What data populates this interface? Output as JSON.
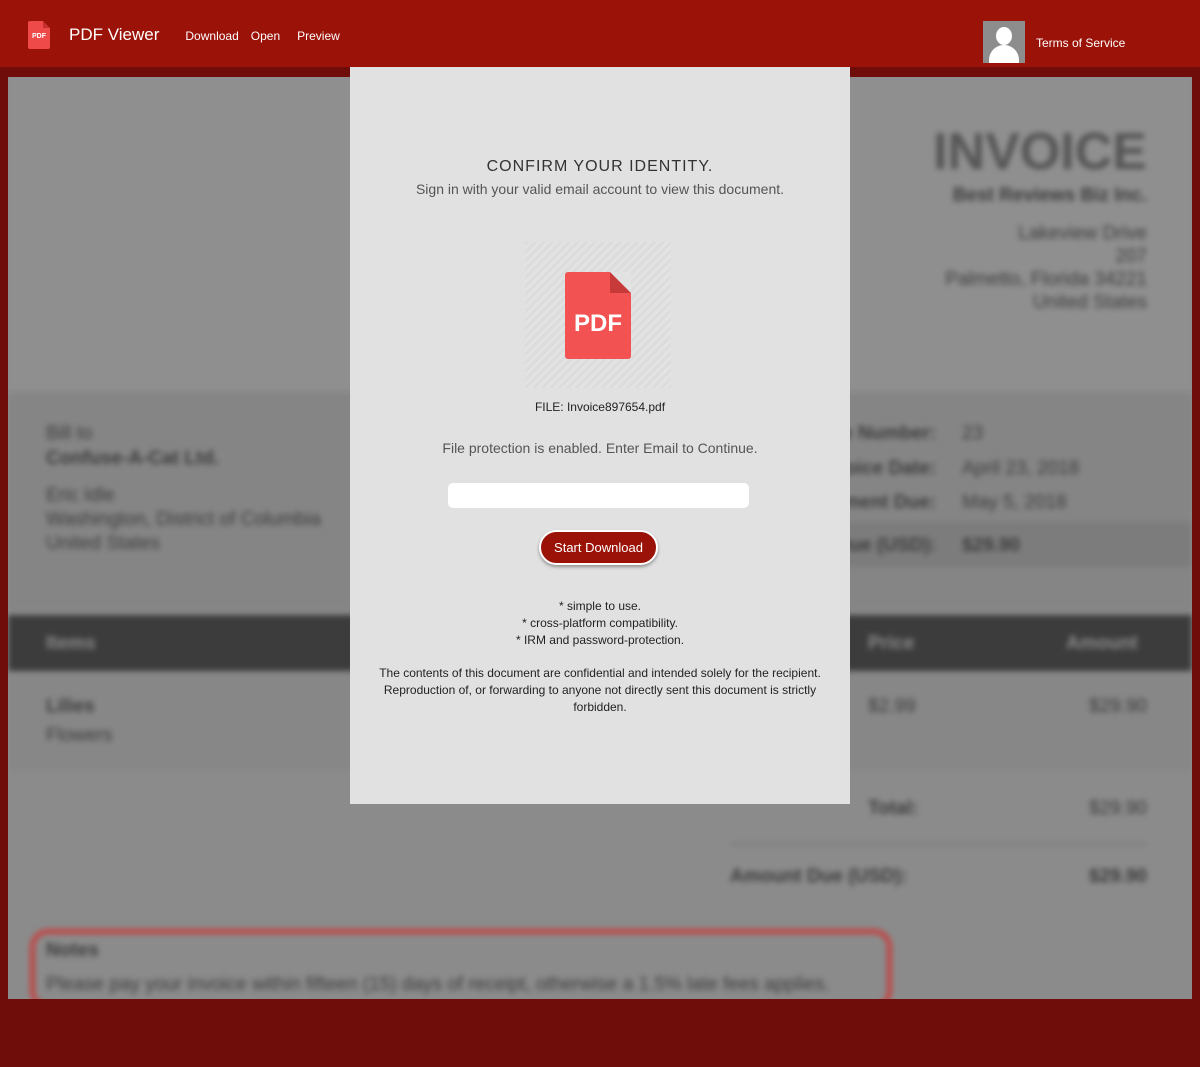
{
  "header": {
    "logo_text": "PDF",
    "app_title": "PDF Viewer",
    "nav": [
      "Download",
      "Open",
      "Preview"
    ],
    "terms_link": "Terms of Service"
  },
  "modal": {
    "title": "CONFIRM YOUR IDENTITY.",
    "subtitle": "Sign in with your valid email account to view this document.",
    "icon_label": "PDF",
    "file_name": "FILE: Invoice897654.pdf",
    "protection_text": "File protection is enabled. Enter Email to Continue.",
    "email_value": "",
    "button_label": "Start Download",
    "features": [
      "* simple to use.",
      "* cross-platform compatibility.",
      "* IRM and password-protection."
    ],
    "disclaimer": "The contents of this document are confidential and intended solely for the recipient. Reproduction of, or forwarding to anyone not directly sent this document is strictly forbidden."
  },
  "background_document": {
    "title": "INVOICE",
    "company": "Best Reviews Biz Inc.",
    "address": [
      "Lakeview Drive",
      "207",
      "Palmetto, Florida 34221",
      "United States"
    ],
    "bill_to_label": "Bill to",
    "bill_to_name": "Confuse-A-Cat Ltd.",
    "bill_to_address": [
      "Eric Idle",
      "Washington, District of Columbia",
      "United States"
    ],
    "meta": [
      {
        "label": "Invoice Number:",
        "value": "23"
      },
      {
        "label": "Invoice Date:",
        "value": "April 23, 2018"
      },
      {
        "label": "Payment Due:",
        "value": "May 5, 2018"
      },
      {
        "label": "Amount Due (USD):",
        "value": "$29.90"
      }
    ],
    "table_headers": [
      "Items",
      "Price",
      "Amount"
    ],
    "item_name": "Lilies",
    "item_desc": "Flowers",
    "item_price": "$2.99",
    "item_amount": "$29.90",
    "total_label": "Total:",
    "total_value": "$29.90",
    "amount_due_label": "Amount Due (USD):",
    "amount_due_value": "$29.90",
    "notes_label": "Notes",
    "notes_text": "Please pay your invoice within fifteen (15) days of receipt, otherwise a 1.5% late fees applies."
  },
  "colors": {
    "header_bg": "#9a1208",
    "page_bg": "#6e0d0a",
    "modal_bg": "#e1e1e1",
    "pdf_icon": "#f25252"
  }
}
